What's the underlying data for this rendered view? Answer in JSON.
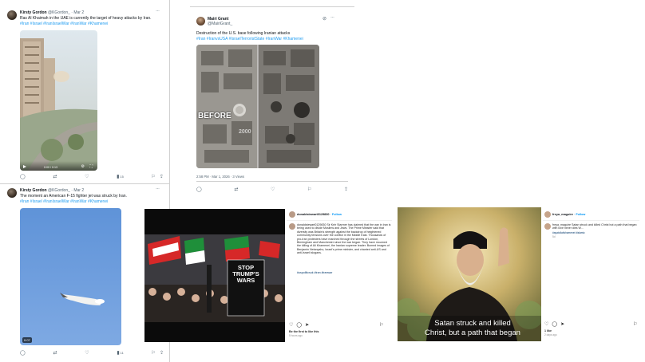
{
  "tweet1": {
    "name": "Kirsty Gordon",
    "handle": "@KGordon_",
    "date": "· Mar 2",
    "text": "Ras Al Khaimah in the UAE is currently the target of heavy attacks by Iran.",
    "tags": "#Iran #Israel #IranIsraelWar #IranWar #Khamenei",
    "video_time": "0:00 / 0:13",
    "views": "15"
  },
  "tweet2": {
    "name": "Mairi Grant",
    "handle": "@MairiGrant_",
    "text": "Destruction of the U.S. base following Iranian attacks",
    "tags": "#Iran #IranvsUSA #IsraelTerroristState #IranWar #Khamenei",
    "before_label": "BEFORE",
    "watermark": "2000",
    "timestamp": "2:58 PM · Mar 1, 2026 · 3 Views"
  },
  "tweet3": {
    "name": "Kirsty Gordon",
    "handle": "@KGordon_",
    "date": "· Mar 2",
    "text": "The moment an American F-15 fighter jet was struck by Iran.",
    "tags": "#Iran #Israel #IranIsraelWar #IranWar #Khamenei",
    "video_time": "0:07",
    "views": "11"
  },
  "ig1": {
    "username": "donaldstewart0129830",
    "follow": "Follow",
    "caption": "donaldstewart0129830 Sir Keir Starmer has claimed that the war in Iran is being used to divide Muslims and Jews. The Prime Minister said that diversity was Britain's strength against the backdrop of heightened community tensions over the conflict in the Middle East. Thousands of pro-Iran protesters have marched through the streets of London, Birmingham and Manchester since the war began. They have mourned the killing of Ali Khamenei, the Iranian supreme leader. Burned images of Benjamin Netanyahu, Israel's prime minister, and chanted anti-US and anti-Israeli slogans.",
    "tags": "#uspoliticsuk #iran #iranwar",
    "likes": "Be the first to like this",
    "age": "5 hours ago",
    "sign1": "STOP",
    "sign2": "TRUMP'S",
    "sign3": "WARS"
  },
  "ig2": {
    "username": "freya_maguire",
    "follow": "Follow",
    "caption": "freya_maguire Satan struck and killed Christ but a path that began with love never dies W...",
    "tags": "#ayatollahkhamenei #islamic",
    "tag_extra": "5d",
    "likes": "1 like",
    "age": "2 days ago",
    "overlay_line1": "Satan struck and killed",
    "overlay_line2": "Christ, but a path that began"
  },
  "colors": {
    "link": "#1d9bf0",
    "ig_follow": "#0095f6",
    "text": "#0f1419",
    "muted": "#536471"
  }
}
